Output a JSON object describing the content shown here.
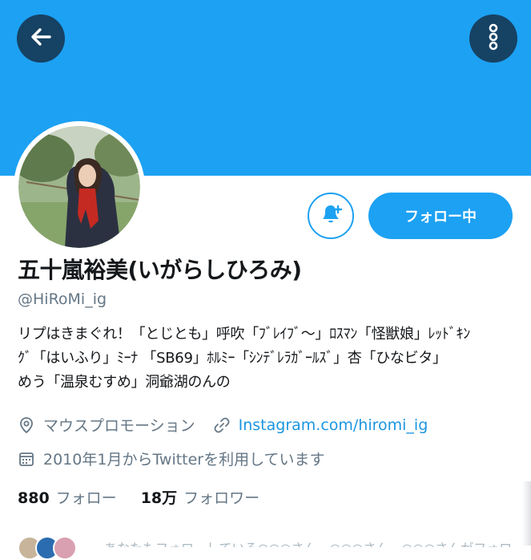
{
  "profile": {
    "name": "五十嵐裕美(いがらしひろみ)",
    "handle": "@HiRoMi_ig",
    "bio_lines": [
      "リプはきまぐれ！「とじとも」呼吹「ﾌﾞﾚｲﾌﾞ～」ﾛｽﾏﾝ「怪獣娘」ﾚｯﾄﾞｷﾝ",
      "ｸﾞ「はいふり」ﾐｰﾅ 「SB69」ﾎﾙﾐｰ「ｼﾝﾃﾞﾚﾗｶﾞｰﾙｽﾞ」杏「ひなビタ」",
      "めう「温泉むすめ」洞爺湖のんの"
    ],
    "location": "マウスプロモーション",
    "website": "Instagram.com/hiromi_ig",
    "joined": "2010年1月からTwitterを利用しています"
  },
  "actions": {
    "follow_label": "フォロー中"
  },
  "stats": {
    "following_count": "880",
    "following_label": "フォロー",
    "followers_count": "18万",
    "followers_label": "フォロワー"
  },
  "bottom_preview": {
    "text": "あなたもフォローしている○○○さん、○○○さん、○○○さんがフォロー中"
  },
  "colors": {
    "banner": "#1da1f2",
    "accent": "#1da1f2",
    "link": "#1b95e0",
    "secondary_text": "#657786"
  },
  "icons": {
    "back": "arrow-left-icon",
    "more": "more-vertical-icon",
    "notify": "bell-plus-icon",
    "location": "location-pin-icon",
    "link": "link-icon",
    "calendar": "calendar-icon"
  }
}
